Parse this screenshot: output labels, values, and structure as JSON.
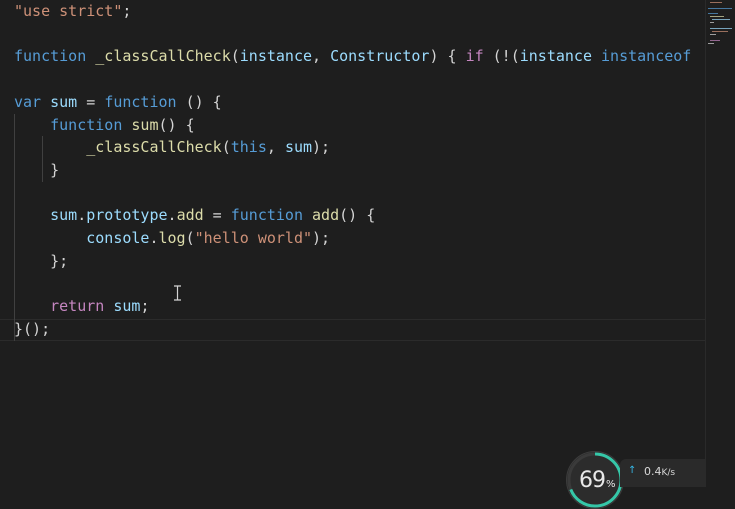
{
  "editor": {
    "lines": [
      [
        [
          "str",
          "\"use strict\""
        ],
        [
          "pl",
          ";"
        ]
      ],
      [],
      [
        [
          "kw",
          "function "
        ],
        [
          "fn",
          "_classCallCheck"
        ],
        [
          "pl",
          "("
        ],
        [
          "var",
          "instance"
        ],
        [
          "pl",
          ", "
        ],
        [
          "var",
          "Constructor"
        ],
        [
          "pl",
          ") { "
        ],
        [
          "ctl",
          "if"
        ],
        [
          "pl",
          " (!("
        ],
        [
          "var",
          "instance "
        ],
        [
          "kw",
          "instanceof"
        ]
      ],
      [],
      [
        [
          "kw",
          "var "
        ],
        [
          "var",
          "sum"
        ],
        [
          "pl",
          " = "
        ],
        [
          "kw",
          "function"
        ],
        [
          "pl",
          " () {"
        ]
      ],
      [
        [
          "pl",
          "    "
        ],
        [
          "kw",
          "function "
        ],
        [
          "fn",
          "sum"
        ],
        [
          "pl",
          "() {"
        ]
      ],
      [
        [
          "pl",
          "        "
        ],
        [
          "fn",
          "_classCallCheck"
        ],
        [
          "pl",
          "("
        ],
        [
          "kw",
          "this"
        ],
        [
          "pl",
          ", "
        ],
        [
          "var",
          "sum"
        ],
        [
          "pl",
          ");"
        ]
      ],
      [
        [
          "pl",
          "    }"
        ]
      ],
      [],
      [
        [
          "pl",
          "    "
        ],
        [
          "var",
          "sum"
        ],
        [
          "pl",
          "."
        ],
        [
          "var",
          "prototype"
        ],
        [
          "pl",
          "."
        ],
        [
          "fn",
          "add"
        ],
        [
          "pl",
          " = "
        ],
        [
          "kw",
          "function "
        ],
        [
          "fn",
          "add"
        ],
        [
          "pl",
          "() {"
        ]
      ],
      [
        [
          "pl",
          "        "
        ],
        [
          "var",
          "console"
        ],
        [
          "pl",
          "."
        ],
        [
          "fn",
          "log"
        ],
        [
          "pl",
          "("
        ],
        [
          "str",
          "\"hello world\""
        ],
        [
          "pl",
          ");"
        ]
      ],
      [
        [
          "pl",
          "    };"
        ]
      ],
      [],
      [
        [
          "pl",
          "    "
        ],
        [
          "ctl",
          "return "
        ],
        [
          "var",
          "sum"
        ],
        [
          "pl",
          ";"
        ]
      ],
      [
        [
          "pl",
          "}();"
        ]
      ]
    ]
  },
  "widget": {
    "percent": "69",
    "percent_unit": "%",
    "percent_value": 0.69,
    "speed_arrow": "↑",
    "speed_value": "0.4",
    "speed_unit": "K/s"
  },
  "colors": {
    "background": "#1e1e1e",
    "keyword": "#569cd6",
    "control": "#c586c0",
    "string": "#ce9178",
    "function": "#dcdcaa",
    "variable": "#9cdcfe",
    "plain": "#d4d4d4",
    "gauge_arc": "#35c7a8",
    "upload_arrow": "#35b6e6"
  }
}
